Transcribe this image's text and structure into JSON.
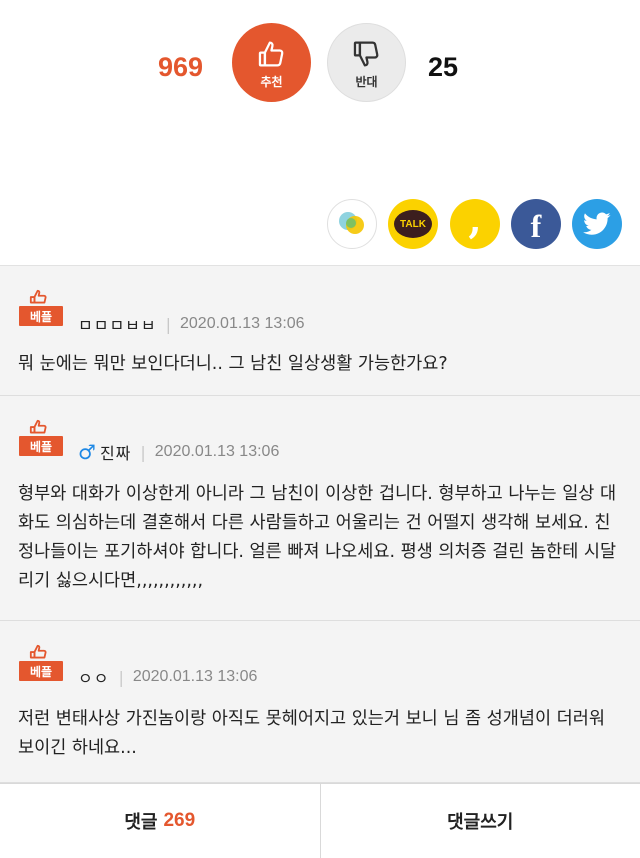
{
  "vote": {
    "recommend_count": "969",
    "recommend_label": "추천",
    "oppose_label": "반대",
    "oppose_count": "25"
  },
  "share": {
    "icons": [
      "band-icon",
      "kakaotalk-icon",
      "kakaostory-icon",
      "facebook-icon",
      "twitter-icon"
    ],
    "kakaotalk_text": "TALK"
  },
  "colors": {
    "accent": "#e4572e",
    "kakao": "#fbd200",
    "facebook": "#3b5998",
    "twitter": "#2c9fe5"
  },
  "comments": [
    {
      "badge": "베플",
      "author": "ㅁㅁㅁㅂㅂ",
      "date": "2020.01.13 13:06",
      "text": "뭐 눈에는 뭐만 보인다더니.. 그 남친 일상생활 가능한가요?"
    },
    {
      "badge": "베플",
      "gender_icon": "♂",
      "author": "진짜",
      "date": "2020.01.13 13:06",
      "text": "형부와 대화가 이상한게 아니라 그 남친이 이상한 겁니다. 형부하고 나누는 일상 대화도 의심하는데 결혼해서 다른 사람들하고 어울리는 건 어떨지 생각해 보세요. 친정나들이는 포기하셔야 합니다. 얼른 빠져 나오세요. 평생 의처증 걸린 놈한테 시달리기 싫으시다면,,,,,,,,,,,,"
    },
    {
      "badge": "베플",
      "author": "ㅇㅇ",
      "date": "2020.01.13 13:06",
      "text": "저런 변태사상 가진놈이랑 아직도 못헤어지고 있는거 보니 님 좀 성개념이 더러워 보이긴 하네요..."
    }
  ],
  "footer": {
    "comments_label": "댓글",
    "comments_count": "269",
    "write_label": "댓글쓰기"
  }
}
